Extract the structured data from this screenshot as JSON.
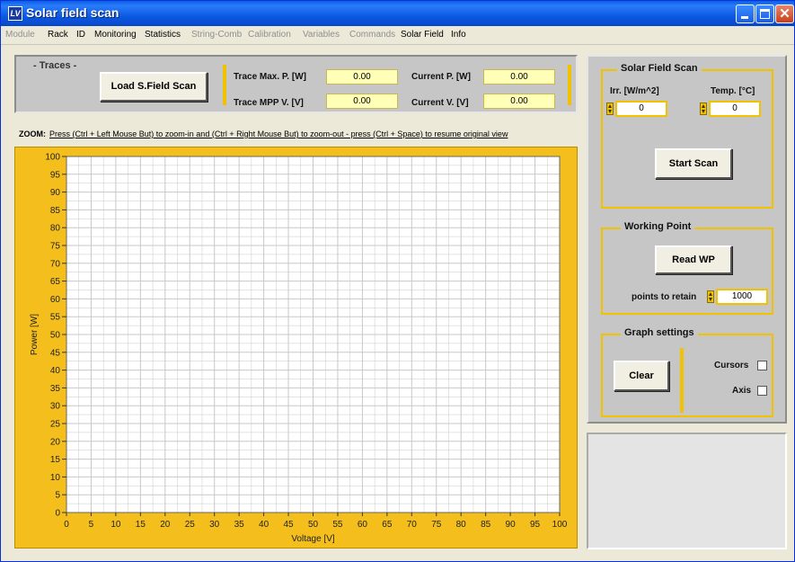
{
  "window": {
    "title": "Solar field scan",
    "icon_text": "LV"
  },
  "menu": [
    {
      "label": "Module",
      "enabled": false
    },
    {
      "label": "Rack",
      "enabled": true
    },
    {
      "label": "ID",
      "enabled": true
    },
    {
      "label": "Monitoring",
      "enabled": true
    },
    {
      "label": "Statistics",
      "enabled": true
    },
    {
      "label": "String-Comb",
      "enabled": false
    },
    {
      "label": "Calibration",
      "enabled": false
    },
    {
      "label": "Variables",
      "enabled": false
    },
    {
      "label": "Commands",
      "enabled": false
    },
    {
      "label": "Solar Field",
      "enabled": true
    },
    {
      "label": "Info",
      "enabled": true
    }
  ],
  "traces": {
    "label": "- Traces -",
    "load_button": "Load S.Field Scan",
    "trace_max_p_label": "Trace Max. P. [W]",
    "trace_max_p_value": "0.00",
    "trace_mpp_v_label": "Trace MPP V. [V]",
    "trace_mpp_v_value": "0.00",
    "current_p_label": "Current P. [W]",
    "current_p_value": "0.00",
    "current_v_label": "Current V. [V]",
    "current_v_value": "0.00"
  },
  "zoom": {
    "label": "ZOOM:",
    "hint": "Press (Ctrl + Left Mouse But) to zoom-in and (Ctrl + Right Mouse But) to zoom-out - press (Ctrl + Space) to resume original view"
  },
  "scan": {
    "title": "Solar Field Scan",
    "irr_label": "Irr. [W/m^2]",
    "irr_value": "0",
    "temp_label": "Temp. [°C]",
    "temp_value": "0",
    "start_button": "Start Scan"
  },
  "working_point": {
    "title": "Working Point",
    "read_button": "Read WP",
    "retain_label": "points to retain",
    "retain_value": "1000"
  },
  "graph_settings": {
    "title": "Graph settings",
    "clear_button": "Clear",
    "cursors_label": "Cursors",
    "cursors_checked": false,
    "axis_label": "Axis",
    "axis_checked": false
  },
  "chart_data": {
    "type": "line",
    "series": [],
    "xlabel": "Voltage [V]",
    "ylabel": "Power [W]",
    "xlim": [
      0,
      100
    ],
    "ylim": [
      0,
      100
    ],
    "x_ticks": [
      "0",
      "5",
      "10",
      "15",
      "20",
      "25",
      "30",
      "35",
      "40",
      "45",
      "50",
      "55",
      "60",
      "65",
      "70",
      "75",
      "80",
      "85",
      "90",
      "95",
      "100"
    ],
    "y_ticks": [
      "0",
      "5",
      "10",
      "15",
      "20",
      "25",
      "30",
      "35",
      "40",
      "45",
      "50",
      "55",
      "60",
      "65",
      "70",
      "75",
      "80",
      "85",
      "90",
      "95",
      "100"
    ],
    "grid": true,
    "colors": {
      "frame": "#f4bf1c",
      "plot_bg": "#ffffff",
      "grid": "#c8c8c8"
    }
  }
}
